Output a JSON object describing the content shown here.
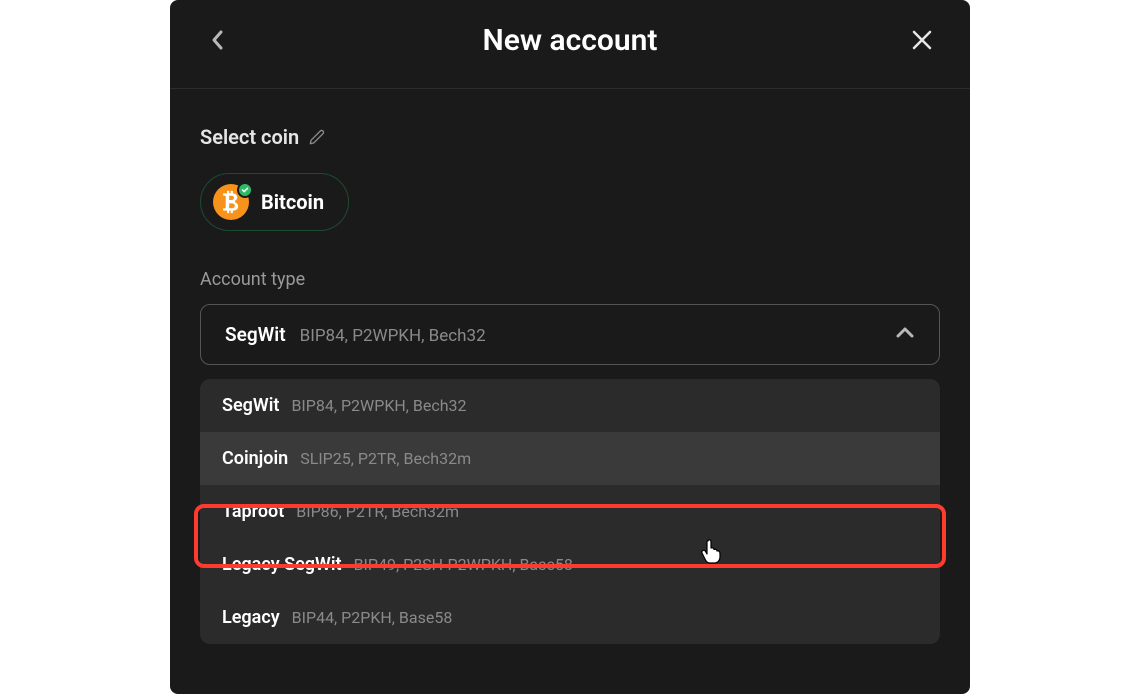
{
  "header": {
    "title": "New account"
  },
  "select_coin": {
    "label": "Select coin",
    "selected": "Bitcoin"
  },
  "account_type": {
    "label": "Account type",
    "selected": {
      "name": "SegWit",
      "detail": "BIP84, P2WPKH, Bech32"
    },
    "options": [
      {
        "name": "SegWit",
        "detail": "BIP84, P2WPKH, Bech32",
        "highlighted": false
      },
      {
        "name": "Coinjoin",
        "detail": "SLIP25, P2TR, Bech32m",
        "highlighted": true
      },
      {
        "name": "Taproot",
        "detail": "BIP86, P2TR, Bech32m",
        "highlighted": false
      },
      {
        "name": "Legacy SegWit",
        "detail": "BIP49, P2SH-P2WPKH, Base58",
        "highlighted": false
      },
      {
        "name": "Legacy",
        "detail": "BIP44, P2PKH, Base58",
        "highlighted": false
      }
    ]
  },
  "colors": {
    "accent_green": "#2abb64",
    "bitcoin_orange": "#f7931a",
    "highlight_red": "#ff3b30"
  }
}
